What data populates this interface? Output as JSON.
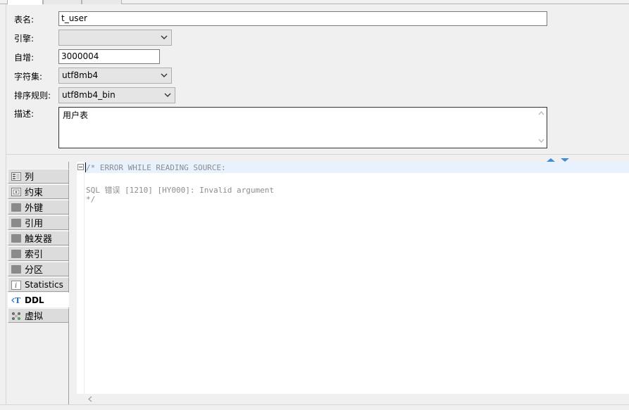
{
  "form": {
    "table_name": {
      "label": "表名:",
      "value": "t_user"
    },
    "engine": {
      "label": "引擎:",
      "value": ""
    },
    "auto_increment": {
      "label": "自增:",
      "value": "3000004"
    },
    "charset": {
      "label": "字符集:",
      "value": "utf8mb4"
    },
    "collation": {
      "label": "排序规则:",
      "value": "utf8mb4_bin"
    },
    "comment": {
      "label": "描述:",
      "value": "用户表"
    }
  },
  "sidebar": {
    "items": [
      {
        "label": "列",
        "icon": "columns-icon"
      },
      {
        "label": "约束",
        "icon": "constraint-icon"
      },
      {
        "label": "外键",
        "icon": "folder-icon"
      },
      {
        "label": "引用",
        "icon": "folder-icon"
      },
      {
        "label": "触发器",
        "icon": "folder-icon"
      },
      {
        "label": "索引",
        "icon": "folder-icon"
      },
      {
        "label": "分区",
        "icon": "folder-icon"
      },
      {
        "label": "Statistics",
        "icon": "info-icon"
      },
      {
        "label": "DDL",
        "icon": "ddl-icon",
        "active": true
      },
      {
        "label": "虚拟",
        "icon": "virtual-icon"
      }
    ]
  },
  "editor": {
    "lines": [
      "/* ERROR WHILE READING SOURCE:",
      "",
      "SQL 错误 [1210] [HY000]: Invalid argument",
      "*/"
    ]
  },
  "colors": {
    "line_highlight": "#e8f2fe",
    "comment_text": "#8c8c8c",
    "splitter_arrows": "#3c8dd6"
  }
}
